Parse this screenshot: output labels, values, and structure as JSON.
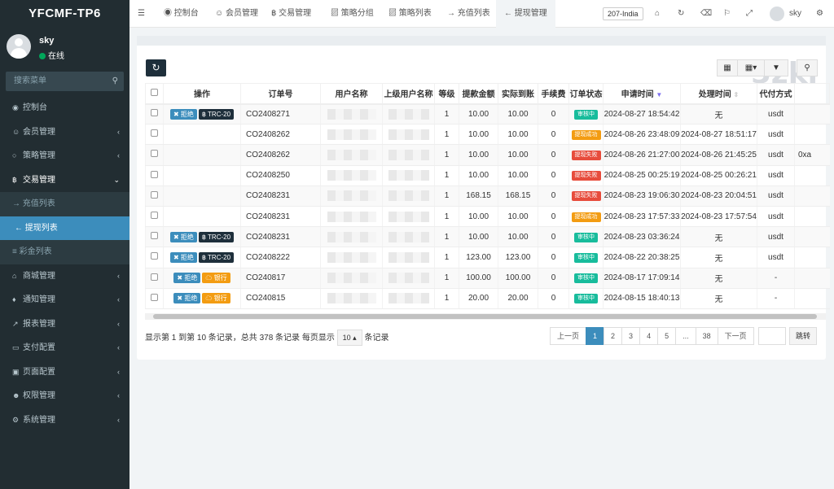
{
  "app": {
    "title": "YFCMF-TP6"
  },
  "user": {
    "name": "sky",
    "status": "在线"
  },
  "search": {
    "placeholder": "搜索菜单"
  },
  "menu": [
    {
      "label": "控制台",
      "icon": "dashboard-icon"
    },
    {
      "label": "会员管理",
      "icon": "user-icon"
    },
    {
      "label": "策略管理",
      "icon": "gamepad-icon"
    },
    {
      "label": "交易管理",
      "icon": "bitcoin-icon"
    },
    {
      "label": "充值列表",
      "icon": "signin-icon"
    },
    {
      "label": "提现列表",
      "icon": "signout-icon"
    },
    {
      "label": "彩金列表",
      "icon": "list-icon"
    },
    {
      "label": "商城管理",
      "icon": "home-icon"
    },
    {
      "label": "通知管理",
      "icon": "bell-icon"
    },
    {
      "label": "报表管理",
      "icon": "chart-icon"
    },
    {
      "label": "支付配置",
      "icon": "card-icon"
    },
    {
      "label": "页面配置",
      "icon": "desktop-icon"
    },
    {
      "label": "权限管理",
      "icon": "group-icon"
    },
    {
      "label": "系统管理",
      "icon": "cogs-icon"
    }
  ],
  "tabs": [
    "控制台",
    "会员管理",
    "交易管理",
    "策略分组",
    "策略列表",
    "充值列表",
    "提现管理"
  ],
  "top": {
    "region": "207-India",
    "user": "sky"
  },
  "watermark": "5zki",
  "table": {
    "headers": [
      "操作",
      "订单号",
      "用户名称",
      "上级用户名称",
      "等级",
      "提款金额",
      "实际到账",
      "手续费",
      "订单状态",
      "申请时间",
      "处理时间",
      "代付方式",
      ""
    ],
    "rows": [
      {
        "ops": [
          "拒绝",
          "TRC-20"
        ],
        "order": "CO2408271",
        "level": "1",
        "amount": "10.00",
        "actual": "10.00",
        "fee": "0",
        "status": "审核中",
        "scolor": "green",
        "apply": "2024-08-27 18:54:42",
        "process": "无",
        "method": "usdt",
        "extra": ""
      },
      {
        "ops": [],
        "order": "CO2408262",
        "level": "1",
        "amount": "10.00",
        "actual": "10.00",
        "fee": "0",
        "status": "提现成功",
        "scolor": "orange",
        "apply": "2024-08-26 23:48:09",
        "process": "2024-08-27 18:51:17",
        "method": "usdt",
        "extra": ""
      },
      {
        "ops": [],
        "order": "CO2408262",
        "level": "1",
        "amount": "10.00",
        "actual": "10.00",
        "fee": "0",
        "status": "提现失败",
        "scolor": "red",
        "apply": "2024-08-26 21:27:00",
        "process": "2024-08-26 21:45:25",
        "method": "usdt",
        "extra": "0xa"
      },
      {
        "ops": [],
        "order": "CO2408250",
        "level": "1",
        "amount": "10.00",
        "actual": "10.00",
        "fee": "0",
        "status": "提现失败",
        "scolor": "red",
        "apply": "2024-08-25 00:25:19",
        "process": "2024-08-25 00:26:21",
        "method": "usdt",
        "extra": ""
      },
      {
        "ops": [],
        "order": "CO2408231",
        "level": "1",
        "amount": "168.15",
        "actual": "168.15",
        "fee": "0",
        "status": "提现失败",
        "scolor": "red",
        "apply": "2024-08-23 19:06:30",
        "process": "2024-08-23 20:04:51",
        "method": "usdt",
        "extra": ""
      },
      {
        "ops": [],
        "order": "CO2408231",
        "level": "1",
        "amount": "10.00",
        "actual": "10.00",
        "fee": "0",
        "status": "提现成功",
        "scolor": "orange",
        "apply": "2024-08-23 17:57:33",
        "process": "2024-08-23 17:57:54",
        "method": "usdt",
        "extra": ""
      },
      {
        "ops": [
          "拒绝",
          "TRC-20"
        ],
        "order": "CO2408231",
        "level": "1",
        "amount": "10.00",
        "actual": "10.00",
        "fee": "0",
        "status": "审核中",
        "scolor": "green",
        "apply": "2024-08-23 03:36:24",
        "process": "无",
        "method": "usdt",
        "extra": ""
      },
      {
        "ops": [
          "拒绝",
          "TRC-20"
        ],
        "order": "CO2408222",
        "level": "1",
        "amount": "123.00",
        "actual": "123.00",
        "fee": "0",
        "status": "审核中",
        "scolor": "green",
        "apply": "2024-08-22 20:38:25",
        "process": "无",
        "method": "usdt",
        "extra": ""
      },
      {
        "ops": [
          "拒绝",
          "银行"
        ],
        "order": "CO240817",
        "level": "1",
        "amount": "100.00",
        "actual": "100.00",
        "fee": "0",
        "status": "审核中",
        "scolor": "green",
        "apply": "2024-08-17 17:09:14",
        "process": "无",
        "method": "-",
        "extra": ""
      },
      {
        "ops": [
          "拒绝",
          "银行"
        ],
        "order": "CO240815",
        "level": "1",
        "amount": "20.00",
        "actual": "20.00",
        "fee": "0",
        "status": "审核中",
        "scolor": "green",
        "apply": "2024-08-15 18:40:13",
        "process": "无",
        "method": "-",
        "extra": ""
      }
    ]
  },
  "footer": {
    "text1": "显示第 1 到第 10 条记录，总共 378 条记录 每页显示",
    "page_size": "10",
    "text2": "条记录"
  },
  "pager": {
    "prev": "上一页",
    "pages": [
      "1",
      "2",
      "3",
      "4",
      "5",
      "...",
      "38"
    ],
    "next": "下一页",
    "jump": "跳转"
  }
}
